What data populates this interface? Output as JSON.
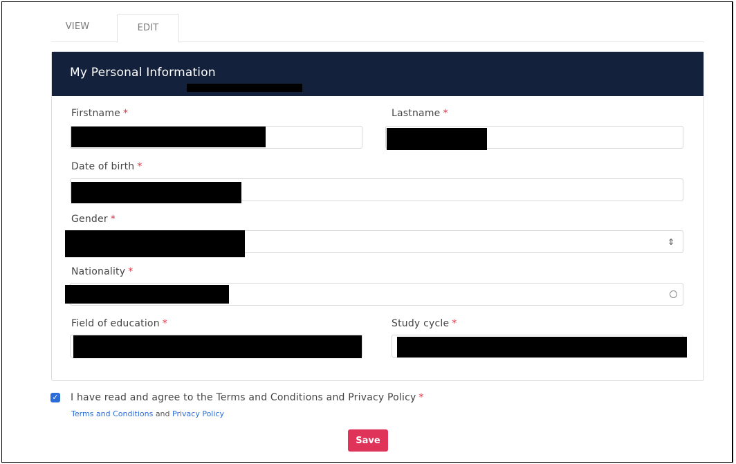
{
  "tabs": [
    {
      "label": "VIEW"
    },
    {
      "label": "EDIT"
    }
  ],
  "card": {
    "title": "My Personal Information"
  },
  "fields": {
    "firstname": {
      "label": "Firstname",
      "required": "*"
    },
    "lastname": {
      "label": "Lastname",
      "required": "*"
    },
    "dob": {
      "label": "Date of birth",
      "required": "*"
    },
    "gender": {
      "label": "Gender",
      "required": "*",
      "arrow": "⇕"
    },
    "nationality": {
      "label": "Nationality",
      "required": "*"
    },
    "field_of_education": {
      "label": "Field of education",
      "required": "*"
    },
    "study_cycle": {
      "label": "Study cycle",
      "required": "*"
    }
  },
  "agreement": {
    "checked": true,
    "text": "I have read and agree to the Terms and Conditions and Privacy Policy",
    "required": "*",
    "link_terms": "Terms and Conditions",
    "and": "and",
    "link_privacy": "Privacy Policy"
  },
  "save_label": "Save",
  "colors": {
    "header_bg": "#14213d",
    "accent_blue": "#2b6cd6",
    "save_bg": "#e0335a",
    "required": "#dc3545"
  }
}
